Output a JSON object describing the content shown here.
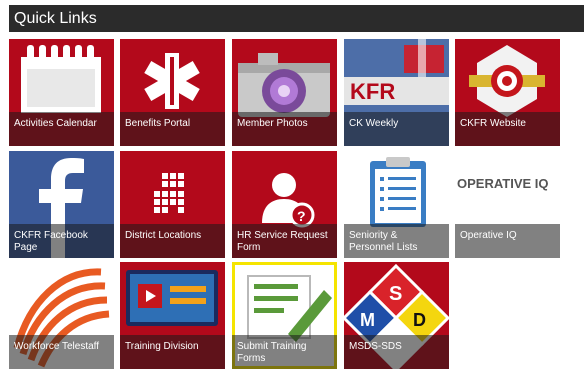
{
  "header": {
    "title": "Quick Links"
  },
  "tiles": [
    {
      "label": "Activities Calendar",
      "icon": "calendar-icon"
    },
    {
      "label": "Benefits Portal",
      "icon": "star-of-life-icon"
    },
    {
      "label": "Member Photos",
      "icon": "camera-icon"
    },
    {
      "label": "CK Weekly",
      "icon": "newsletter-photo-icon"
    },
    {
      "label": "CKFR Website",
      "icon": "fire-department-badge-icon"
    },
    {
      "label": "CKFR Facebook Page",
      "icon": "facebook-icon"
    },
    {
      "label": "District Locations",
      "icon": "building-icon"
    },
    {
      "label": "HR Service Request Form",
      "icon": "user-question-icon"
    },
    {
      "label": "Seniority & Personnel Lists",
      "icon": "clipboard-list-icon"
    },
    {
      "label": "Operative IQ",
      "icon": "operative-iq-logo",
      "logo_text": "OPERATIVE IQ"
    },
    {
      "label": "Workforce Telestaff",
      "icon": "telestaff-logo-icon"
    },
    {
      "label": "Training Division",
      "icon": "video-player-icon"
    },
    {
      "label": "Submit Training Forms",
      "icon": "edit-form-icon"
    },
    {
      "label": "MSDS-SDS",
      "icon": "hazard-diamond-icon",
      "diamond": {
        "top": "S",
        "left": "M",
        "right": "D"
      }
    }
  ],
  "colors": {
    "header_bg": "#2b2b2b",
    "tile_red": "#b3091b",
    "facebook_blue": "#3b5a9a",
    "selected_outline": "#f5e400"
  }
}
